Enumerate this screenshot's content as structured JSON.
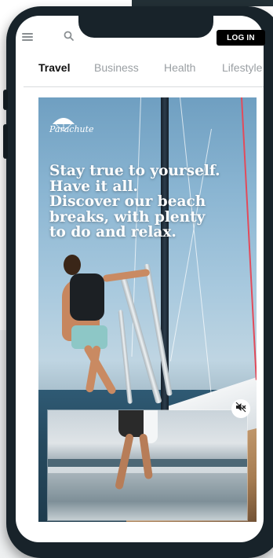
{
  "header": {
    "menu_icon": "hamburger-menu-icon",
    "search_icon": "search-icon",
    "login_label": "LOG IN"
  },
  "tabs": [
    {
      "label": "Travel",
      "active": true
    },
    {
      "label": "Business",
      "active": false
    },
    {
      "label": "Health",
      "active": false
    },
    {
      "label": "Lifestyle",
      "active": false
    }
  ],
  "hero": {
    "brand": "Parachute",
    "brand_icon": "parachute-logo-icon",
    "headline_lines": [
      "Stay true to yourself.",
      "Have it all.",
      "Discover our beach",
      "breaks, with plenty",
      "to do and relax."
    ],
    "mute_icon": "speaker-muted-icon"
  },
  "colors": {
    "login_bg": "#000000",
    "active_tab": "#111111",
    "inactive_tab": "#9a9fa3",
    "phone_frame": "#18232a",
    "headline_text": "#ffffff"
  }
}
